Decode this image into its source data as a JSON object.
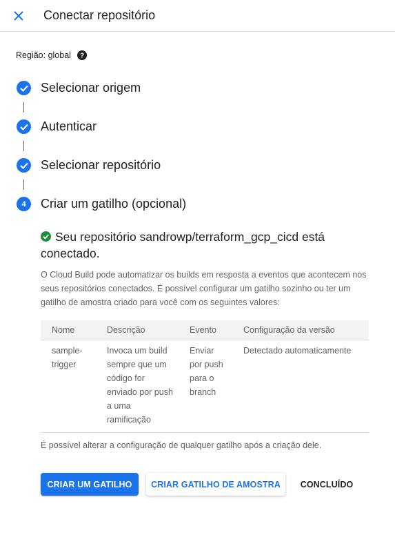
{
  "header": {
    "title": "Conectar repositório",
    "close_icon": "close-icon"
  },
  "region": {
    "label": "Região:",
    "value": "global",
    "help_icon": "help-icon"
  },
  "steps": [
    {
      "label": "Selecionar origem",
      "status": "done"
    },
    {
      "label": "Autenticar",
      "status": "done"
    },
    {
      "label": "Selecionar repositório",
      "status": "done"
    },
    {
      "label": "Criar um gatilho (opcional)",
      "status": "current",
      "number": "4"
    }
  ],
  "success": {
    "message": "Seu repositório sandrowp/terraform_gcp_cicd está conectado."
  },
  "description": "O Cloud Build pode automatizar os builds em resposta a eventos que acontecem nos seus repositórios conectados. É possível configurar um gatilho sozinho ou ter um gatilho de amostra criado para você com os seguintes valores:",
  "table": {
    "headers": [
      "Nome",
      "Descrição",
      "Evento",
      "Configuração da versão"
    ],
    "rows": [
      [
        "sample-trigger",
        "Invoca um build sempre que um código for enviado por push a uma ramificação",
        "Enviar por push para o branch",
        "Detectado automaticamente"
      ]
    ]
  },
  "note": "É possível alterar a configuração de qualquer gatilho após a criação dele.",
  "buttons": {
    "primary": "CRIAR UM GATILHO",
    "sample": "CRIAR GATILHO DE AMOSTRA",
    "done": "CONCLUÍDO"
  },
  "colors": {
    "accent": "#1a73e8",
    "success": "#1e8e3e",
    "text": "#202124",
    "secondary_text": "#5f6368"
  }
}
